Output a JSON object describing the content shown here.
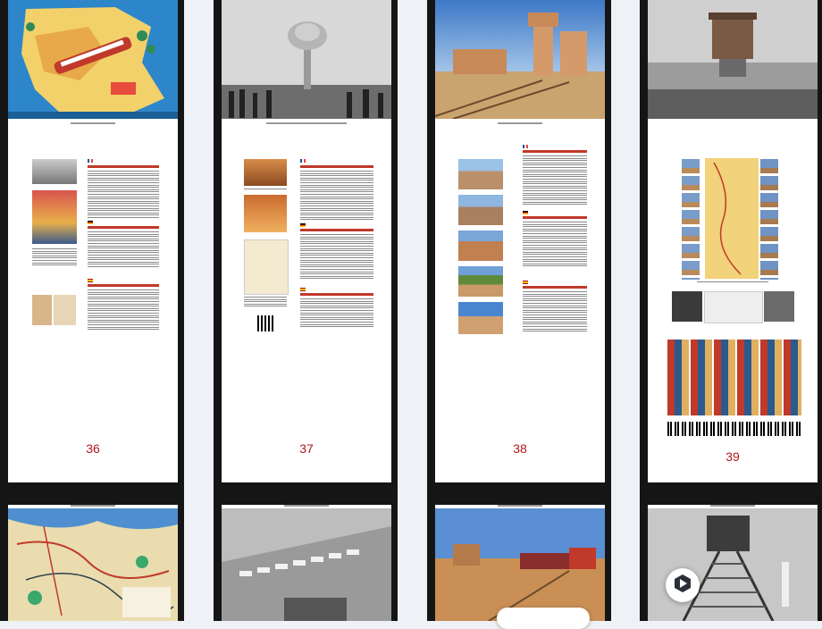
{
  "viewer": {
    "pages": [
      {
        "number": "36"
      },
      {
        "number": "37"
      },
      {
        "number": "38"
      },
      {
        "number": "39"
      }
    ]
  },
  "colors": {
    "page_number": "#b0181e",
    "heading_red": "#c0392b",
    "gutter": "#eef1f5",
    "frame_dark": "#151515"
  },
  "icons": {
    "fab": "play-logo-icon",
    "pill": "search-icon"
  }
}
